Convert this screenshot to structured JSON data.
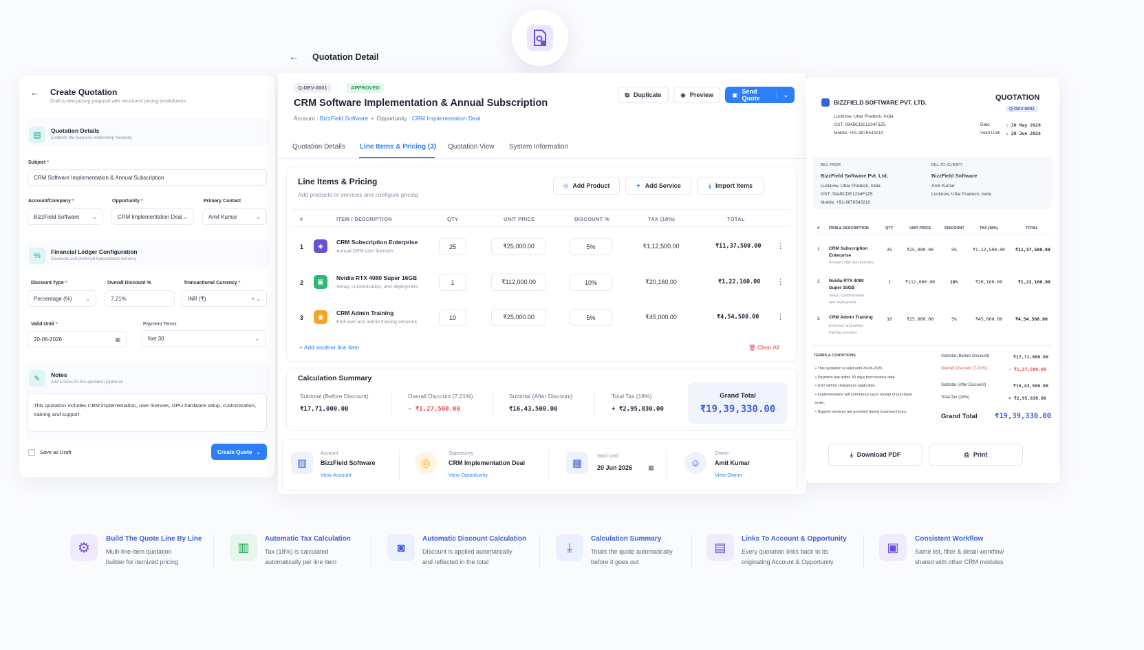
{
  "left": {
    "title": "Create Quotation",
    "subtitle": "Draft a new pricing proposal with structured pricing breakdowns",
    "section1": {
      "title": "Quotation Details",
      "subtitle": "Establish the business relationship hierarchy"
    },
    "subject_label": "Subject",
    "subject_value": "CRM Software Implementation & Annual Subscription",
    "account_label": "Account/Company",
    "account_value": "BizzField Software",
    "opportunity_label": "Opportunity",
    "opportunity_value": "CRM Implementation Deal",
    "contact_label": "Primary Contact",
    "contact_value": "Amit Kumar",
    "section2": {
      "title": "Financial Ledger Configuration",
      "subtitle": "Discounts and preferred transactional currency"
    },
    "discount_type_label": "Discount Type",
    "discount_type_value": "Percentage (%)",
    "overall_discount_label": "Overall Discount %",
    "overall_discount_value": "7.21%",
    "currency_label": "Transactional Currency",
    "currency_value": "INR (₹)",
    "valid_until_label": "Valid Until",
    "valid_until_value": "20-06-2026",
    "payment_terms_label": "Payment Terms",
    "payment_terms_value": "Net 30",
    "notes_title": "Notes",
    "notes_subtitle": "Add a notes for this quotation (optional)",
    "notes_text": "This quotation includes CRM implementation, user licenses, GPU hardware setup, customization, training and support.",
    "save_draft": "Save as Draft",
    "create_btn": "Create Quote"
  },
  "detail": {
    "title": "Quotation Detail",
    "id_badge": "Q-DEV-0001",
    "status_badge": "APPROVED",
    "heading": "CRM Software Implementation & Annual Subscription",
    "account_label": "Account :",
    "account": "BizzField Software",
    "opportunity_label": "Opportunity :",
    "opportunity": "CRM Implementation Deal",
    "dup_btn": "Duplicate",
    "preview_btn": "Preview",
    "send_btn": "Send Quote",
    "tabs": [
      "Quotation Details",
      "Line Items & Pricing (3)",
      "Quotation View",
      "System Information"
    ],
    "li_title": "Line Items & Pricing",
    "li_subtitle": "Add products or services and configure pricing",
    "add_product": "Add Product",
    "add_service": "Add Service",
    "import_items": "Import Items",
    "cols": [
      "#",
      "ITEM / DESCRIPTION",
      "QTY",
      "UNIT PRICE",
      "DISCOUNT %",
      "TAX (18%)",
      "TOTAL"
    ],
    "rows": [
      {
        "n": "1",
        "name": "CRM Subscription Enterprise",
        "desc": "Annual CRM user licenses",
        "qty": "25",
        "price": "₹25,000.00",
        "disc": "5%",
        "tax": "₹1,12,500.00",
        "total": "₹11,37,500.00"
      },
      {
        "n": "2",
        "name": "Nvidia RTX 4080 Super 16GB",
        "desc": "Setup, customization, and deployment",
        "qty": "1",
        "price": "₹112,000.00",
        "disc": "10%",
        "tax": "₹20,160.00",
        "total": "₹1,22,160.00"
      },
      {
        "n": "3",
        "name": "CRM Admin Training",
        "desc": "End-user and admin training sessions",
        "qty": "10",
        "price": "₹25,000.00",
        "disc": "5%",
        "tax": "₹45,000.00",
        "total": "₹4,54,500.00"
      }
    ],
    "add_line": "Add another line item",
    "clear_all": "Clear All",
    "calc_title": "Calculation Summary",
    "sub_before_label": "Subtotal (Before Discount)",
    "sub_before": "₹17,71,000.00",
    "overall_disc_label": "Overall Discount (7.21%)",
    "overall_disc": "- ₹1,27,500.00",
    "sub_after_label": "Subtotal (After Discount)",
    "sub_after": "₹16,43,500.00",
    "tax_label": "Total Tax (18%)",
    "tax": "+ ₹2,95,830.00",
    "grand_label": "Grand Total",
    "grand": "₹19,39,330.00",
    "info_account_label": "Account",
    "info_account": "BizzField Software",
    "info_account_link": "View Account",
    "info_opp_label": "Opportunity",
    "info_opp": "CRM Implementation Deal",
    "info_opp_link": "View Opportunity",
    "info_valid_label": "Valid Until",
    "info_valid": "20 Jun 2026",
    "info_owner_label": "Owner",
    "info_owner": "Amit Kumar",
    "info_owner_link": "View Owner"
  },
  "preview": {
    "company": "BIZZFIELD SOFTWARE PVT. LTD.",
    "addr": "Lucknow, Uttar Pradesh, India",
    "gst": "GST: 09ABCDE1234F1Z5",
    "mobile": "Mobile: +91-9876543210",
    "doc_title": "QUOTATION",
    "doc_id": "Q-DEV-0001",
    "date_label": "Date",
    "date": ": 20 May 2026",
    "valid_label": "Valid Until",
    "valid": ": 20 Jun 2026",
    "bill_from_label": "BILL FROM",
    "bill_from_name": "BizzField Software Pvt. Ltd.",
    "bill_from_addr": "Lucknow, Uttar Pradesh, India",
    "bill_from_gst": "GST: 09ABCDE1234F1Z5",
    "bill_from_mobile": "Mobile: +91-9876543210",
    "bill_to_label": "BILL TO (CLIENT)",
    "bill_to_name": "BizzField Software",
    "bill_to_contact": "Amit Kumar",
    "bill_to_addr": "Lucknow, Uttar Pradesh, India",
    "cols": [
      "#",
      "ITEM & DESCRIPTION",
      "QTY",
      "UNIT PRICE",
      "DISCOUNT",
      "TAX (18%)",
      "TOTAL"
    ],
    "rows": [
      {
        "n": "1",
        "name": "CRM Subscription Enterprise",
        "desc": "Annual CRM user licenses",
        "qty": "25",
        "price": "₹25,000.00",
        "disc": "5%",
        "tax": "₹1,12,500.00",
        "total": "₹11,37,500.00"
      },
      {
        "n": "2",
        "name": "Nvidia RTX 4080 Super 16GB",
        "desc": "Setup, customization, and deployment",
        "qty": "1",
        "price": "₹112,000.00",
        "disc": "10%",
        "tax": "₹20,160.00",
        "total": "₹1,22,160.00"
      },
      {
        "n": "3",
        "name": "CRM Admin Training",
        "desc": "End-user and admin training sessions",
        "qty": "10",
        "price": "₹25,000.00",
        "disc": "5%",
        "tax": "₹45,000.00",
        "total": "₹4,54,500.00"
      }
    ],
    "terms_title": "TERMS & CONDITIONS",
    "terms": [
      "This quotation is valid until 20-06-2026.",
      "Payment due within 30 days from invoice date.",
      "GST will be charged as applicable.",
      "Implementation will commence upon receipt of purchase order.",
      "Support services are provided during business hours."
    ],
    "sum_before_label": "Subtotal (Before Discount)",
    "sum_before": "₹17,71,000.00",
    "sum_disc_label": "Overall Discount (7.21%)",
    "sum_disc": "- ₹1,27,500.00",
    "sum_after_label": "Subtotal (After Discount)",
    "sum_after": "₹16,43,500.00",
    "sum_tax_label": "Total Tax (18%)",
    "sum_tax": "+ ₹2,95,830.00",
    "grand_label": "Grand Total",
    "grand": "₹19,39,330.00",
    "download_btn": "Download PDF",
    "print_btn": "Print"
  },
  "features": [
    {
      "title": "Build The Quote Line By Line",
      "desc1": "Multi-line-item quotation",
      "desc2": "builder for itemized pricing"
    },
    {
      "title": "Automatic Tax Calculation",
      "desc1": "Tax (18%) is calculated",
      "desc2": "automatically per line item"
    },
    {
      "title": "Automatic Discount Calculation",
      "desc1": "Discount is applied automatically",
      "desc2": "and reflected in the total"
    },
    {
      "title": "Calculation Summary",
      "desc1": "Totals the quote automatically",
      "desc2": "before it goes out"
    },
    {
      "title": "Links To Account & Opportunity",
      "desc1": "Every quotation links back to its",
      "desc2": "originating Account & Opportunity"
    },
    {
      "title": "Consistent Workflow",
      "desc1": "Same list, filter & detail workflow",
      "desc2": "shared with other CRM modules"
    }
  ],
  "colors": {
    "accent": "#2d7ff9",
    "purple": "#6a4fd8",
    "red": "#e5484d",
    "green": "#1f9d55"
  }
}
